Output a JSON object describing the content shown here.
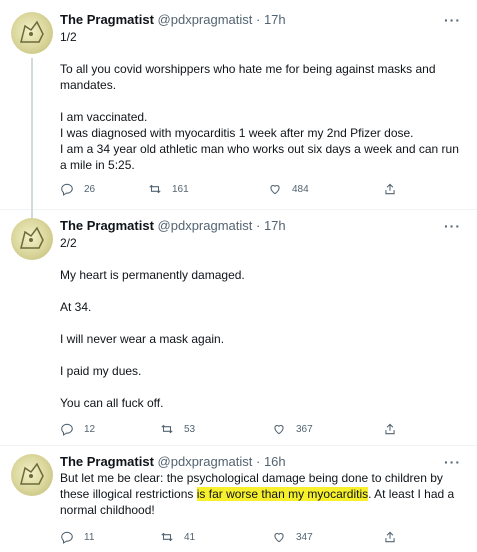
{
  "tweets": [
    {
      "name": "The Pragmatist",
      "meta": "@pdxpragmatist · 17h",
      "lines": [
        "1/2",
        "",
        "To all you covid worshippers who hate me for being against masks and mandates.",
        "",
        "I am vaccinated.",
        "I was diagnosed with myocarditis 1 week after my 2nd Pfizer dose.",
        "I am a 34 year old athletic man who works out six days a week and can run a mile in 5:25."
      ],
      "replies": "26",
      "retweets": "161",
      "likes": "484"
    },
    {
      "name": "The Pragmatist",
      "meta": "@pdxpragmatist · 17h",
      "lines": [
        "2/2",
        "",
        "My heart is permanently damaged.",
        "",
        "At 34.",
        "",
        "I will never wear a mask again.",
        "",
        "I paid my dues.",
        "",
        "You can all fuck off."
      ],
      "replies": "12",
      "retweets": "53",
      "likes": "367"
    },
    {
      "name": "The Pragmatist",
      "meta": "@pdxpragmatist · 16h",
      "text_before": "But let me be clear: the psychological damage being done to children by these illogical restrictions ",
      "text_highlight": "is far worse than my myocarditis",
      "text_after": ". At least I had a normal childhood!",
      "replies": "11",
      "retweets": "41",
      "likes": "347"
    }
  ],
  "more_label": "···",
  "colors": {
    "muted": "#536471",
    "highlight": "#f7f02a",
    "thread_line": "#cfd9de"
  },
  "icons": [
    "reply-icon",
    "retweet-icon",
    "like-icon",
    "share-icon",
    "more-icon"
  ]
}
